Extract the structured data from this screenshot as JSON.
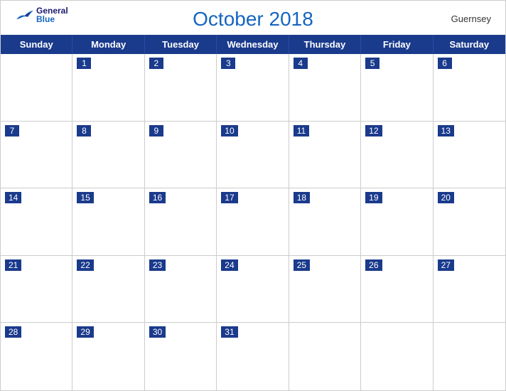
{
  "header": {
    "title": "October 2018",
    "country": "Guernsey",
    "logo": {
      "line1": "General",
      "line2": "Blue"
    }
  },
  "days": [
    "Sunday",
    "Monday",
    "Tuesday",
    "Wednesday",
    "Thursday",
    "Friday",
    "Saturday"
  ],
  "weeks": [
    [
      null,
      1,
      2,
      3,
      4,
      5,
      6
    ],
    [
      7,
      8,
      9,
      10,
      11,
      12,
      13
    ],
    [
      14,
      15,
      16,
      17,
      18,
      19,
      20
    ],
    [
      21,
      22,
      23,
      24,
      25,
      26,
      27
    ],
    [
      28,
      29,
      30,
      31,
      null,
      null,
      null
    ]
  ],
  "colors": {
    "header_bg": "#1a3a8c",
    "header_text": "#ffffff",
    "title_color": "#1565c0",
    "date_num_bg": "#1a3a8c",
    "date_num_text": "#ffffff",
    "cell_border": "#cccccc"
  }
}
